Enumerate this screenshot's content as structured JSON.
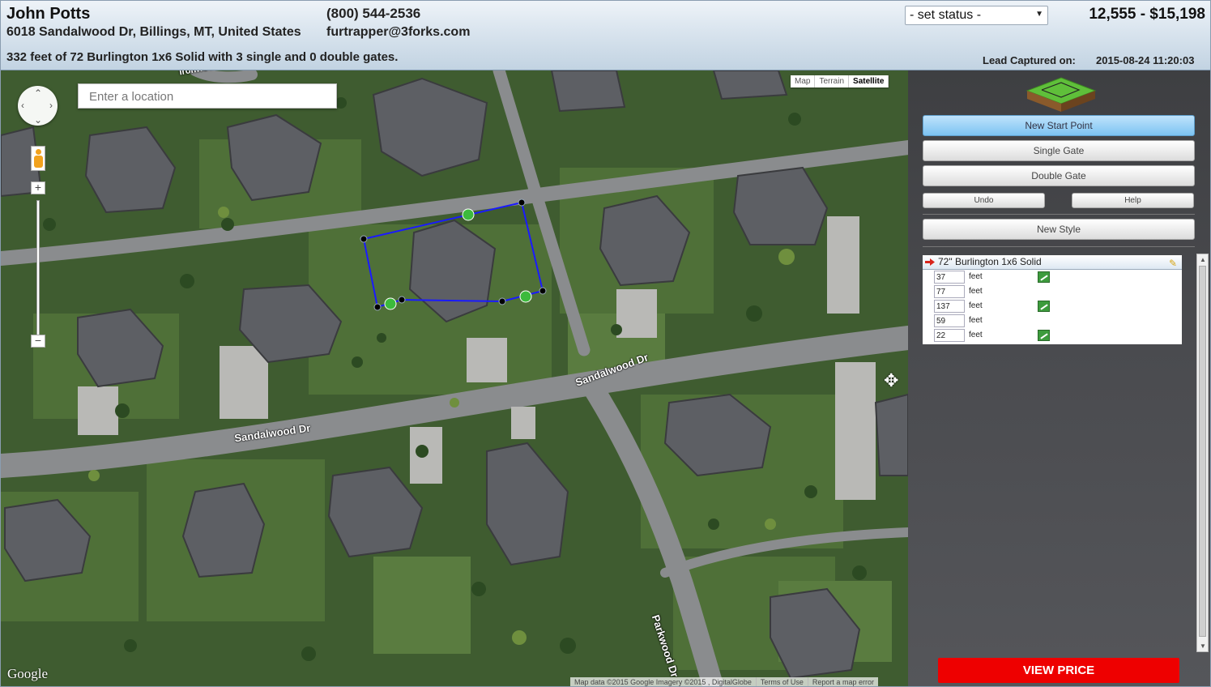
{
  "customer": {
    "name": "John Potts",
    "address": "6018 Sandalwood Dr, Billings, MT, United States",
    "phone": "(800) 544-2536",
    "email": "furtrapper@3forks.com"
  },
  "summary": "332 feet of 72 Burlington 1x6 Solid with 3 single and 0 double gates.",
  "status_select": {
    "value": "- set status -",
    "arrow": "▼"
  },
  "total": "12,555 - $15,198",
  "lead": {
    "label": "Lead Captured on:",
    "date": "2015-08-24 11:20:03"
  },
  "map": {
    "search_placeholder": "Enter a location",
    "zoom_in": "+",
    "zoom_out": "−",
    "types": [
      "Map",
      "Terrain",
      "Satellite"
    ],
    "active_type": "Satellite",
    "logo": "Google",
    "attribution": [
      "Map data ©2015 Google Imagery ©2015 , DigitalGlobe",
      "Terms of Use",
      "Report a map error"
    ],
    "streets": [
      "Sandalwood Dr",
      "Sandalwood Dr",
      "Parkwood Dr",
      "Ironwood Ct"
    ],
    "icons": [
      "pan-control-icon",
      "pegman-icon",
      "move-cursor-icon"
    ]
  },
  "panel": {
    "buttons": {
      "new_start_point": "New Start Point",
      "single_gate": "Single Gate",
      "double_gate": "Double Gate",
      "undo": "Undo",
      "help": "Help",
      "new_style": "New Style"
    },
    "style": {
      "name": "72\" Burlington 1x6 Solid",
      "segments": [
        {
          "length": "37",
          "unit": "feet",
          "gate": true
        },
        {
          "length": "77",
          "unit": "feet",
          "gate": false
        },
        {
          "length": "137",
          "unit": "feet",
          "gate": true
        },
        {
          "length": "59",
          "unit": "feet",
          "gate": false
        },
        {
          "length": "22",
          "unit": "feet",
          "gate": true
        }
      ]
    },
    "view_price": "VIEW PRICE"
  },
  "colors": {
    "accent_blue": "#7cc3f2",
    "fence_line": "#1a1aff",
    "gate_green": "#3d9b3d",
    "view_price": "#ee0000"
  }
}
